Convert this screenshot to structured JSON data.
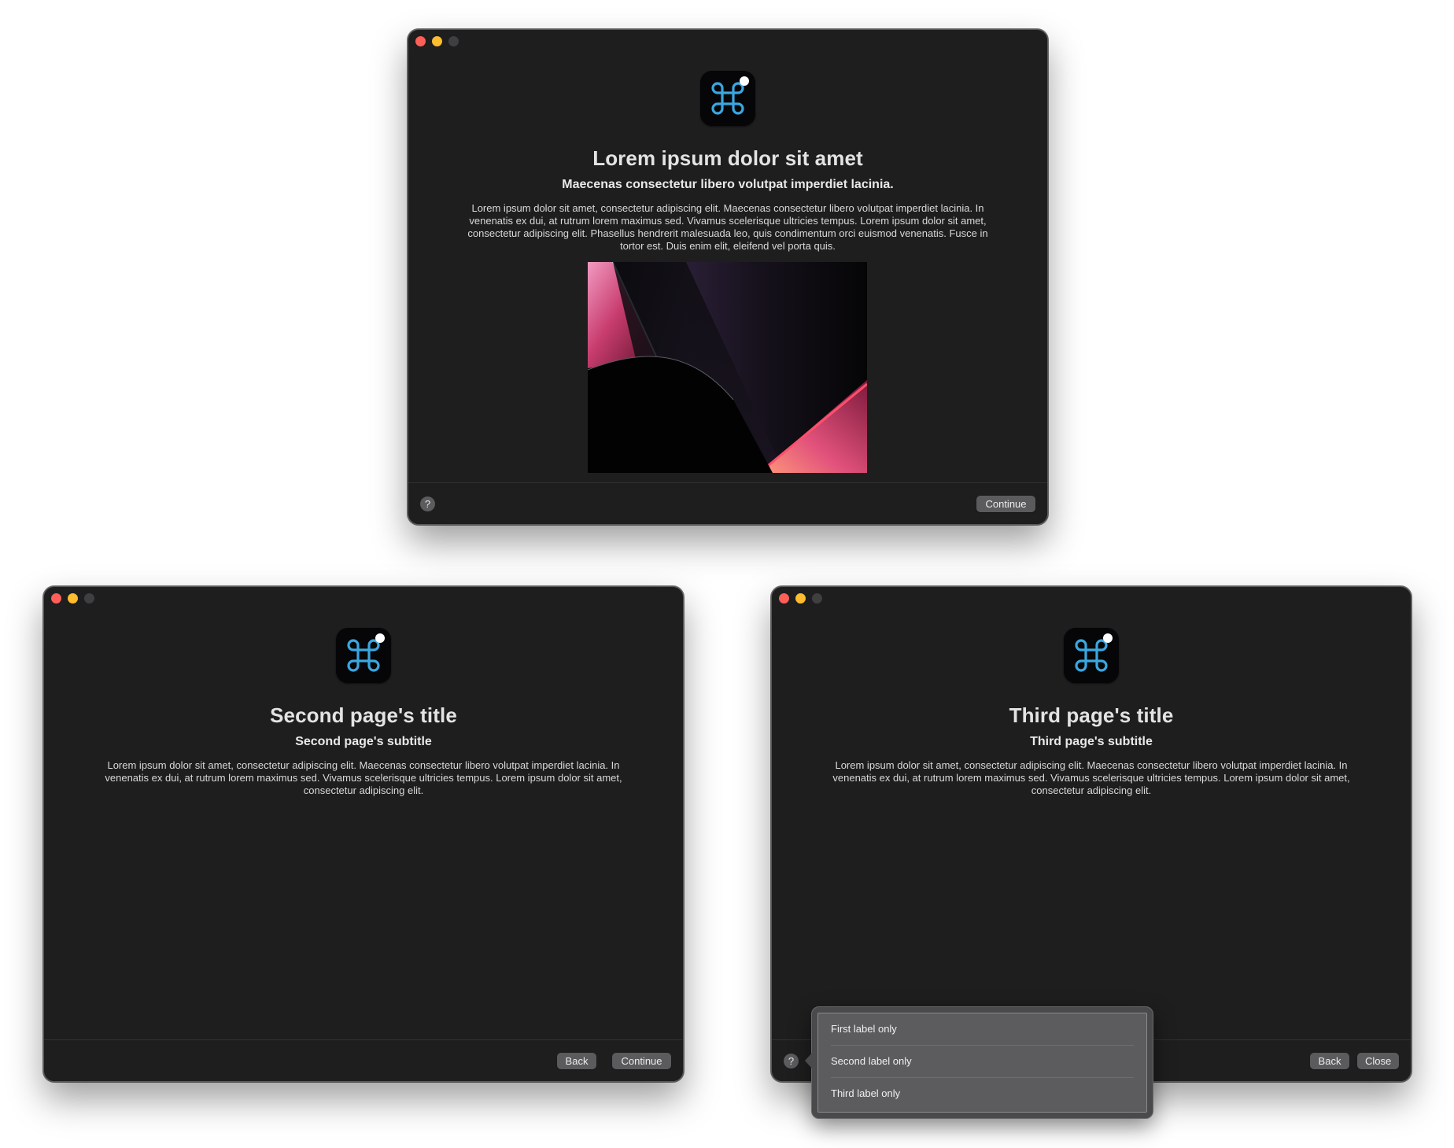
{
  "window1": {
    "title": "Lorem ipsum dolor sit amet",
    "subtitle": "Maecenas consectetur libero volutpat imperdiet lacinia.",
    "body": "Lorem ipsum dolor sit amet, consectetur adipiscing elit. Maecenas consectetur libero volutpat imperdiet lacinia. In venenatis ex dui, at rutrum lorem maximus sed. Vivamus scelerisque ultricies tempus. Lorem ipsum dolor sit amet, consectetur adipiscing elit. Phasellus hendrerit malesuada leo, quis condimentum orci euismod venenatis. Fusce in tortor est. Duis enim elit, eleifend vel porta quis.",
    "help_label": "?",
    "continue_label": "Continue"
  },
  "window2": {
    "title": "Second page's title",
    "subtitle": "Second page's subtitle",
    "body": "Lorem ipsum dolor sit amet, consectetur adipiscing elit. Maecenas consectetur libero volutpat imperdiet lacinia. In venenatis ex dui, at rutrum lorem maximus sed. Vivamus scelerisque ultricies tempus. Lorem ipsum dolor sit amet, consectetur adipiscing elit.",
    "back_label": "Back",
    "continue_label": "Continue"
  },
  "window3": {
    "title": "Third page's title",
    "subtitle": "Third page's subtitle",
    "body": "Lorem ipsum dolor sit amet, consectetur adipiscing elit. Maecenas consectetur libero volutpat imperdiet lacinia. In venenatis ex dui, at rutrum lorem maximus sed. Vivamus scelerisque ultricies tempus. Lorem ipsum dolor sit amet, consectetur adipiscing elit.",
    "help_label": "?",
    "back_label": "Back",
    "close_label": "Close"
  },
  "popover": {
    "items": [
      "First label only",
      "Second label only",
      "Third label only"
    ]
  },
  "icons": {
    "app_icon": "command-key-icon",
    "help": "question-mark-icon"
  },
  "colors": {
    "window_bg": "#1e1e1f",
    "traffic_close": "#fe5f57",
    "traffic_minimize": "#febc2e",
    "traffic_zoom_inactive": "#3f3f41",
    "command_icon_stroke": "#3ba6e0",
    "button_bg": "#5b5b5d"
  }
}
